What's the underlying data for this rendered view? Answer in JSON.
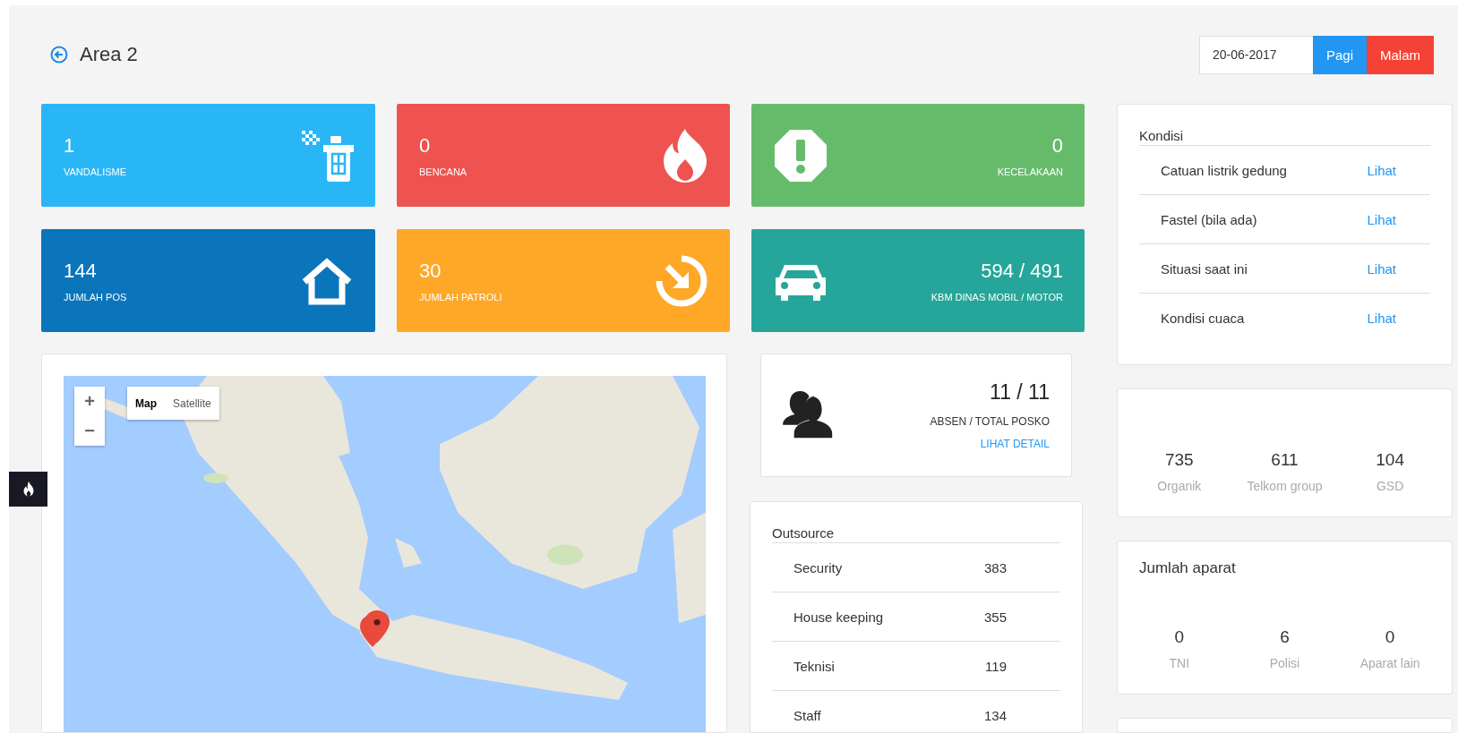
{
  "header": {
    "title": "Area 2",
    "date": "20-06-2017",
    "shift_buttons": [
      {
        "label": "Pagi",
        "color": "#2196f3"
      },
      {
        "label": "Malam",
        "color": "#f44336"
      }
    ]
  },
  "stat_cards": [
    {
      "value": "1",
      "label": "VANDALISME",
      "color": "#29b6f6",
      "kind": "trailing"
    },
    {
      "value": "0",
      "label": "BENCANA",
      "color": "#ef5350",
      "kind": "trailing"
    },
    {
      "value": "0",
      "label": "KECELAKAAN",
      "color": "#66bb6a",
      "kind": "leading"
    },
    {
      "value": "144",
      "label": "JUMLAH POS",
      "color": "#0a75bb",
      "kind": "trailing"
    },
    {
      "value": "30",
      "label": "JUMLAH PATROLI",
      "color": "#ffa726",
      "kind": "trailing"
    },
    {
      "value": "594 / 491",
      "label": "KBM DINAS MOBIL / MOTOR",
      "color": "#26a69a",
      "kind": "leading"
    }
  ],
  "map": {
    "kind": "picture",
    "zoom_buttons": [
      "+",
      "−"
    ],
    "map_types": [
      {
        "label": "Map",
        "selected": true
      },
      {
        "label": "Satellite",
        "selected": false
      }
    ]
  },
  "absen": {
    "value": "11 / 11",
    "label": "ABSEN / TOTAL POSKO",
    "link": "LIHAT DETAIL"
  },
  "outsource": {
    "title": "Outsource",
    "rows": [
      {
        "label": "Security",
        "value": "383"
      },
      {
        "label": "House keeping",
        "value": "355"
      },
      {
        "label": "Teknisi",
        "value": "119"
      },
      {
        "label": "Staff",
        "value": "134"
      }
    ]
  },
  "kondisi": {
    "title": "Kondisi",
    "rows": [
      {
        "label": "Catuan listrik gedung",
        "link": "Lihat"
      },
      {
        "label": "Fastel (bila ada)",
        "link": "Lihat"
      },
      {
        "label": "Situasi saat ini",
        "link": "Lihat"
      },
      {
        "label": "Kondisi cuaca",
        "link": "Lihat"
      }
    ]
  },
  "employee_stats": [
    {
      "value": "735",
      "label": "Organik"
    },
    {
      "value": "611",
      "label": "Telkom group"
    },
    {
      "value": "104",
      "label": "GSD"
    }
  ],
  "aparat": {
    "title": "Jumlah aparat",
    "stats": [
      {
        "value": "0",
        "label": "TNI"
      },
      {
        "value": "6",
        "label": "Polisi"
      },
      {
        "value": "0",
        "label": "Aparat lain"
      }
    ]
  }
}
